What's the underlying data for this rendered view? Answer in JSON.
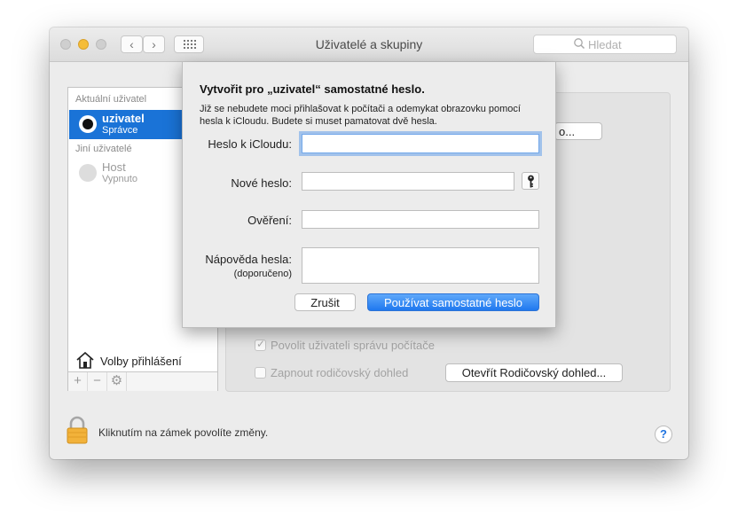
{
  "window": {
    "title": "Uživatelé a skupiny",
    "search_placeholder": "Hledat"
  },
  "sidebar": {
    "current_header": "Aktuální uživatel",
    "current_user": {
      "name": "uzivatel",
      "role": "Správce"
    },
    "others_header": "Jiní uživatelé",
    "other_users": [
      {
        "name": "Host",
        "status": "Vypnuto"
      }
    ],
    "login_options_label": "Volby přihlášení",
    "add_label": "+",
    "remove_label": "−",
    "actions_label": "⚙"
  },
  "panel": {
    "change_password_button_fragment": "o...",
    "allow_admin_label": "Povolit uživateli správu počítače",
    "allow_admin_checked": true,
    "parental_label": "Zapnout rodičovský dohled",
    "parental_checked": false,
    "open_parental_button": "Otevřít Rodičovský dohled..."
  },
  "footer": {
    "lock_message": "Kliknutím na zámek povolíte změny.",
    "help_label": "?"
  },
  "sheet": {
    "title": "Vytvořit pro „uzivatel“ samostatné heslo.",
    "description": "Již se nebudete moci přihlašovat k počítači a odemykat obrazovku pomocí hesla k iCloudu. Budete si muset pamatovat dvě hesla.",
    "fields": {
      "icloud_label": "Heslo k iCloudu:",
      "icloud_value": "",
      "new_label": "Nové heslo:",
      "new_value": "",
      "verify_label": "Ověření:",
      "verify_value": "",
      "hint_label": "Nápověda hesla:",
      "hint_sublabel": "(doporučeno)",
      "hint_value": ""
    },
    "cancel_button": "Zrušit",
    "confirm_button": "Používat samostatné heslo"
  },
  "colors": {
    "accent": "#1a73d7",
    "primary_button": "#2a7ef0",
    "minimize_light": "#f5bd38"
  }
}
